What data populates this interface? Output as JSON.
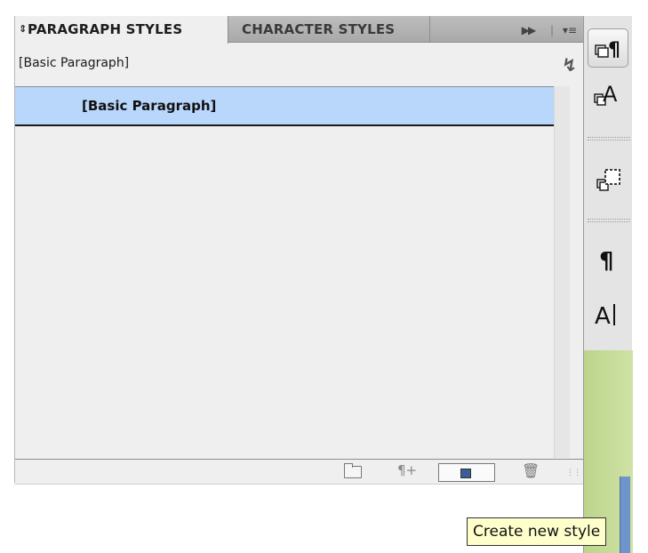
{
  "tabs": [
    {
      "label": "PARAGRAPH STYLES",
      "active": true
    },
    {
      "label": "CHARACTER STYLES",
      "active": false
    }
  ],
  "tab_controls": {
    "collapse_icon": "double-chevron-right-icon",
    "menu_icon": "panel-menu-icon"
  },
  "current_style": "[Basic Paragraph]",
  "styles_list": [
    {
      "label": "[Basic Paragraph]",
      "selected": true
    }
  ],
  "bottom_toolbar": {
    "icons": [
      "folder-icon",
      "clear-overrides-icon",
      "create-new-style-icon",
      "trash-icon"
    ]
  },
  "dock": {
    "buttons": [
      "paragraph-styles-icon",
      "character-styles-icon",
      "object-styles-icon",
      "paragraph-icon",
      "character-icon"
    ]
  },
  "tooltip": "Create new style",
  "colors": {
    "selection": "#b9d6fb",
    "panel_bg": "#efefef",
    "tooltip_bg": "#ffffcc"
  }
}
